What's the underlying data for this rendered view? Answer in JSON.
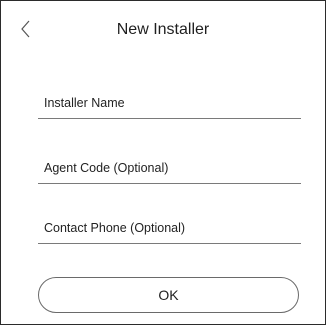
{
  "header": {
    "title": "New Installer",
    "back_icon": "chevron-left-icon"
  },
  "form": {
    "fields": [
      {
        "label": "Installer Name",
        "value": ""
      },
      {
        "label": "Agent Code (Optional)",
        "value": ""
      },
      {
        "label": "Contact Phone (Optional)",
        "value": ""
      }
    ],
    "ok_label": "OK"
  }
}
